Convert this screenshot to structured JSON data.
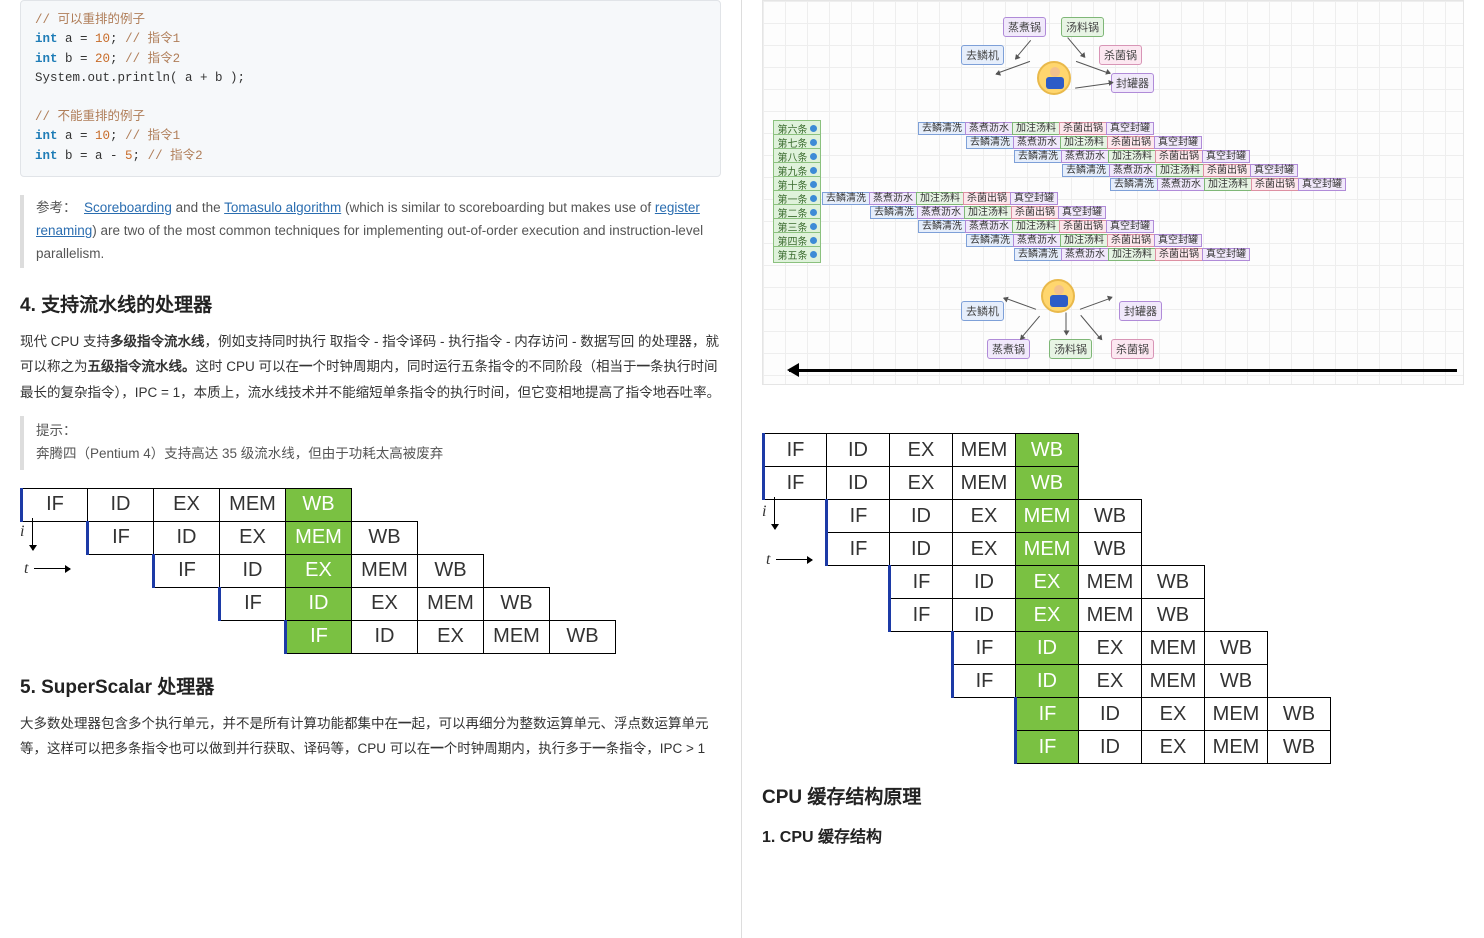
{
  "left": {
    "code": {
      "l1_cmt": "// 可以重排的例子",
      "l2_a": "int a = 10; ",
      "l2_cmt": "// 指令1",
      "l3_a": "int b = 20; ",
      "l3_cmt": "// 指令2",
      "l4": "System.out.println( a + b );",
      "l5_cmt": "// 不能重排的例子",
      "l6_a": "int a = 10; ",
      "l6_cmt": "// 指令1",
      "l7_a": "int b = a - 5; ",
      "l7_cmt": "// 指令2"
    },
    "ref": {
      "prefix": "参考：",
      "link1": "Scoreboarding",
      "mid1": " and the ",
      "link2": "Tomasulo algorithm",
      "mid2": " (which is similar to scoreboarding but makes use of ",
      "link3": "register renaming",
      "tail": ") are two of the most common techniques for implementing out-of-order execution and instruction-level parallelism."
    },
    "sec4": {
      "title": "4. 支持流水线的处理器",
      "p1a": "现代 CPU 支持",
      "p1b": "多级指令流水线",
      "p1c": "，例如支持同时执行 取指令 - 指令译码 - 执行指令 - 内存访问 - 数据写回 的处理器，就可以称之为",
      "p1d": "五级指令流水线。",
      "p1e": "这时 CPU 可以在",
      "p1f": "一",
      "p1g": "个时钟周期内，同时运行五条指令的不同阶段（相当于",
      "p1h": "一",
      "p1i": "条执行时间最长的复杂指令），IPC = 1，本质上，流水线技术并不能缩短单条指令的执行时间，但它变相地提高了指令地吞吐率。",
      "hint_label": "提示：",
      "hint_body": "奔腾四（Pentium 4）支持高达 35 级流水线，但由于功耗太高被废弃"
    },
    "pipe1": {
      "rows": [
        [
          "IF",
          "ID",
          "EX",
          "MEM",
          "WB",
          "",
          "",
          "",
          ""
        ],
        [
          "",
          "IF",
          "ID",
          "EX",
          "MEM",
          "WB",
          "",
          "",
          ""
        ],
        [
          "",
          "",
          "IF",
          "ID",
          "EX",
          "MEM",
          "WB",
          "",
          ""
        ],
        [
          "",
          "",
          "",
          "IF",
          "ID",
          "EX",
          "MEM",
          "WB",
          ""
        ],
        [
          "",
          "",
          "",
          "",
          "IF",
          "ID",
          "EX",
          "MEM",
          "WB"
        ]
      ],
      "highlight_col": 4
    },
    "sec5": {
      "title": "5. SuperScalar 处理器",
      "p1a": "大多数处理器包含多个执行单元，并不是所有计算功能都集中在",
      "p1b": "一",
      "p1c": "起，可以再细分为整数运算单元、浮点数运算单元等，这样可以把多条指令也可以做到并行获取、译码等，CPU 可以在",
      "p1d": "一",
      "p1e": "个时钟周期内，执行多于",
      "p1f": "一",
      "p1g": "条指令，IPC > 1"
    }
  },
  "right": {
    "top_boxes": {
      "row1": [
        "蒸煮锅",
        "汤料锅"
      ],
      "row2": [
        "去鳞机",
        "杀菌锅",
        "封罐器"
      ]
    },
    "gantt": {
      "labels": [
        "第六条",
        "第七条",
        "第八条",
        "第九条",
        "第十条",
        "第一条",
        "第二条",
        "第三条",
        "第四条",
        "第五条"
      ],
      "stages": [
        "去鳞清洗",
        "蒸煮沥水",
        "加注汤料",
        "杀菌出锅",
        "真空封罐"
      ]
    },
    "bottom_boxes": {
      "row1": [
        "去鳞机",
        "封罐器"
      ],
      "row2": [
        "蒸煮锅",
        "汤料锅",
        "杀菌锅"
      ]
    },
    "pipe2": {
      "rows": [
        [
          "IF",
          "ID",
          "EX",
          "MEM",
          "WB",
          "",
          "",
          "",
          "",
          ""
        ],
        [
          "IF",
          "ID",
          "EX",
          "MEM",
          "WB",
          "",
          "",
          "",
          "",
          ""
        ],
        [
          "",
          "IF",
          "ID",
          "EX",
          "MEM",
          "WB",
          "",
          "",
          "",
          ""
        ],
        [
          "",
          "IF",
          "ID",
          "EX",
          "MEM",
          "WB",
          "",
          "",
          "",
          ""
        ],
        [
          "",
          "",
          "IF",
          "ID",
          "EX",
          "MEM",
          "WB",
          "",
          "",
          ""
        ],
        [
          "",
          "",
          "IF",
          "ID",
          "EX",
          "MEM",
          "WB",
          "",
          "",
          ""
        ],
        [
          "",
          "",
          "",
          "IF",
          "ID",
          "EX",
          "MEM",
          "WB",
          "",
          ""
        ],
        [
          "",
          "",
          "",
          "IF",
          "ID",
          "EX",
          "MEM",
          "WB",
          "",
          ""
        ],
        [
          "",
          "",
          "",
          "",
          "IF",
          "ID",
          "EX",
          "MEM",
          "WB",
          ""
        ],
        [
          "",
          "",
          "",
          "",
          "IF",
          "ID",
          "EX",
          "MEM",
          "WB",
          ""
        ]
      ],
      "highlight_col": 4
    },
    "sec_cache": "CPU 缓存结构原理",
    "sub1": "1. CPU 缓存结构"
  },
  "axis": {
    "i": "i",
    "t": "t"
  }
}
